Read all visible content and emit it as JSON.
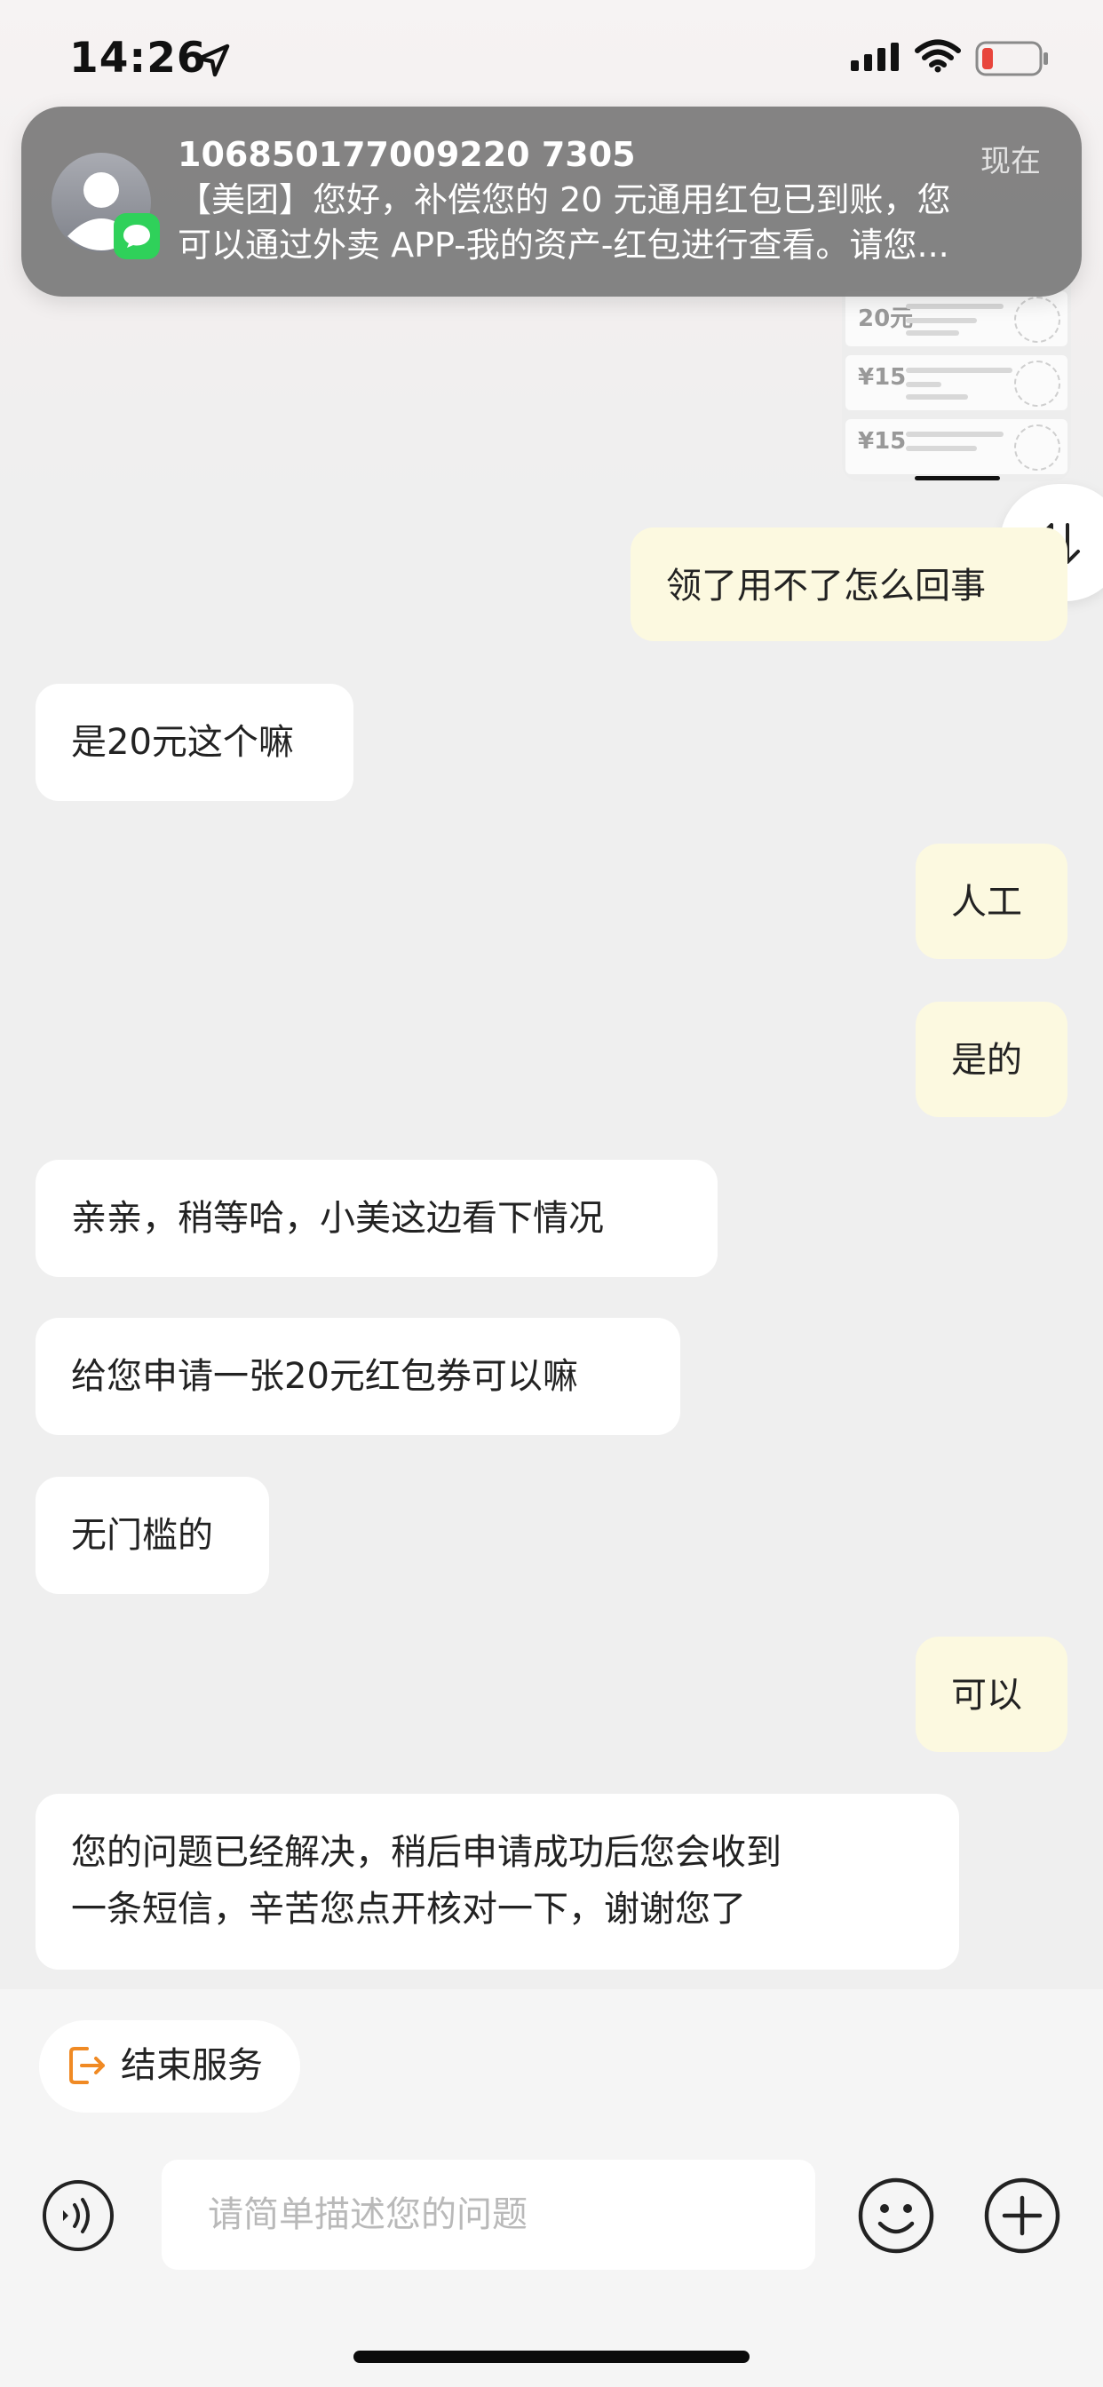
{
  "status_bar": {
    "time": "14:26",
    "icons": [
      "location-arrow-icon",
      "cellular-signal-icon",
      "wifi-icon",
      "battery-low-icon"
    ],
    "battery_color": "#e8453c"
  },
  "notification": {
    "sender": "106850177009220 7305",
    "time": "现在",
    "body_line1": "【美团】您好，补偿您的 20 元通用红包已到账，您",
    "body_line2": "可以通过外卖 APP-我的资产-红包进行查看。请您...",
    "badge_color": "#2fd15a"
  },
  "thumbnail": {
    "coupons": [
      {
        "amount": "20元"
      },
      {
        "amount": "¥15"
      },
      {
        "amount": "¥15"
      }
    ]
  },
  "messages": [
    {
      "side": "right",
      "text": "领了用不了怎么回事"
    },
    {
      "side": "left",
      "text": "是20元这个嘛"
    },
    {
      "side": "right",
      "text": "人工"
    },
    {
      "side": "right",
      "text": "是的"
    },
    {
      "side": "left",
      "text": "亲亲，稍等哈，小美这边看下情况"
    },
    {
      "side": "left",
      "text": "给您申请一张20元红包券可以嘛"
    },
    {
      "side": "left",
      "text": "无门槛的"
    },
    {
      "side": "right",
      "text": "可以"
    },
    {
      "side": "left",
      "text": "您的问题已经解决，稍后申请成功后您会收到",
      "text2": "一条短信，辛苦您点开核对一下，谢谢您了"
    }
  ],
  "bottom": {
    "end_service_label": "结束服务",
    "input_placeholder": "请简单描述您的问题",
    "input_value": "",
    "accent_color": "#f08a24"
  }
}
